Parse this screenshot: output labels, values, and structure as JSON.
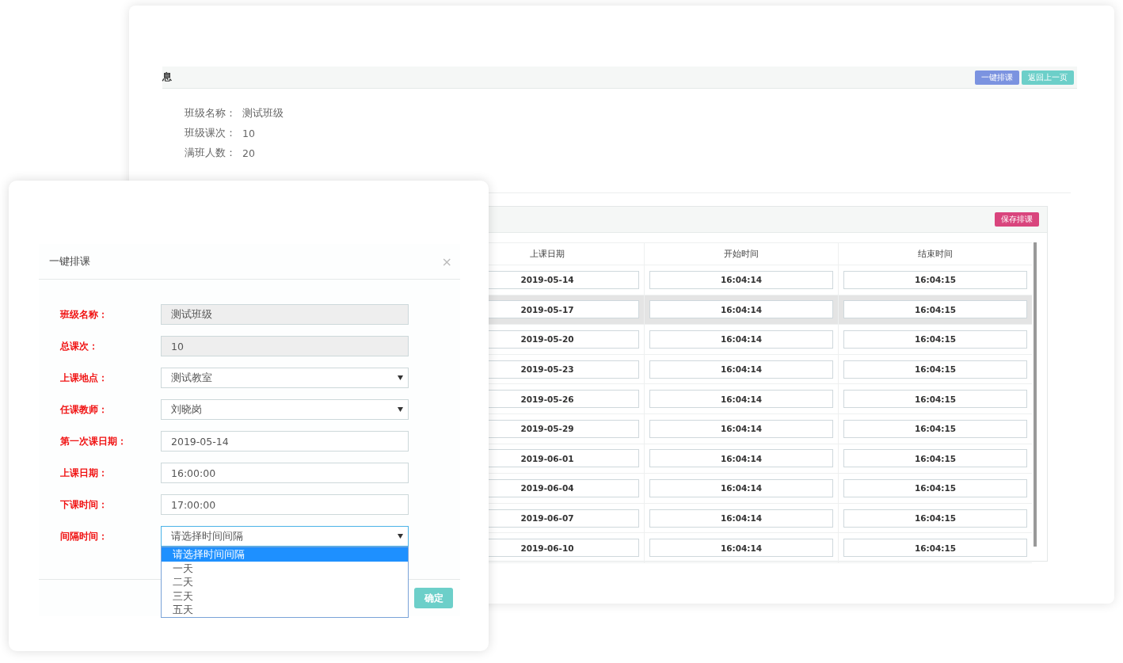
{
  "page": {
    "header_title": "息",
    "buttons": [
      {
        "label": "一键排课",
        "kind": "primary"
      },
      {
        "label": "返回上一页",
        "kind": "back"
      }
    ],
    "info": [
      {
        "label": "班级名称：",
        "value": "测试班级"
      },
      {
        "label": "班级课次：",
        "value": "10"
      },
      {
        "label": "满班人数：",
        "value": "20"
      }
    ],
    "schedule": {
      "save_button": "保存排课",
      "columns": [
        "上课日期",
        "开始时间",
        "结束时间"
      ],
      "rows": [
        {
          "date": "2019-05-14",
          "start": "16:04:14",
          "end": "16:04:15",
          "highlighted": false
        },
        {
          "date": "2019-05-17",
          "start": "16:04:14",
          "end": "16:04:15",
          "highlighted": true
        },
        {
          "date": "2019-05-20",
          "start": "16:04:14",
          "end": "16:04:15",
          "highlighted": false
        },
        {
          "date": "2019-05-23",
          "start": "16:04:14",
          "end": "16:04:15",
          "highlighted": false
        },
        {
          "date": "2019-05-26",
          "start": "16:04:14",
          "end": "16:04:15",
          "highlighted": false
        },
        {
          "date": "2019-05-29",
          "start": "16:04:14",
          "end": "16:04:15",
          "highlighted": false
        },
        {
          "date": "2019-06-01",
          "start": "16:04:14",
          "end": "16:04:15",
          "highlighted": false
        },
        {
          "date": "2019-06-04",
          "start": "16:04:14",
          "end": "16:04:15",
          "highlighted": false
        },
        {
          "date": "2019-06-07",
          "start": "16:04:14",
          "end": "16:04:15",
          "highlighted": false
        },
        {
          "date": "2019-06-10",
          "start": "16:04:14",
          "end": "16:04:15",
          "highlighted": false
        }
      ]
    }
  },
  "dialog": {
    "title": "一键排课",
    "close": "×",
    "fields": [
      {
        "label": "班级名称：",
        "kind": "readonly",
        "value": "测试班级"
      },
      {
        "label": "总课次：",
        "kind": "readonly",
        "value": "10"
      },
      {
        "label": "上课地点：",
        "kind": "select",
        "value": "测试教室",
        "expanded": false
      },
      {
        "label": "任课教师：",
        "kind": "select",
        "value": "刘晓岗",
        "expanded": false
      },
      {
        "label": "第一次课日期：",
        "kind": "text",
        "value": "2019-05-14"
      },
      {
        "label": "上课日期：",
        "kind": "text",
        "value": "16:00:00"
      },
      {
        "label": "下课时间：",
        "kind": "text",
        "value": "17:00:00"
      },
      {
        "label": "间隔时间：",
        "kind": "select",
        "value": "请选择时间间隔",
        "expanded": true,
        "options": [
          {
            "label": "请选择时间间隔",
            "selected": true
          },
          {
            "label": "一天",
            "selected": false
          },
          {
            "label": "二天",
            "selected": false
          },
          {
            "label": "三天",
            "selected": false
          },
          {
            "label": "五天",
            "selected": false
          }
        ]
      }
    ],
    "confirm": "确定"
  }
}
